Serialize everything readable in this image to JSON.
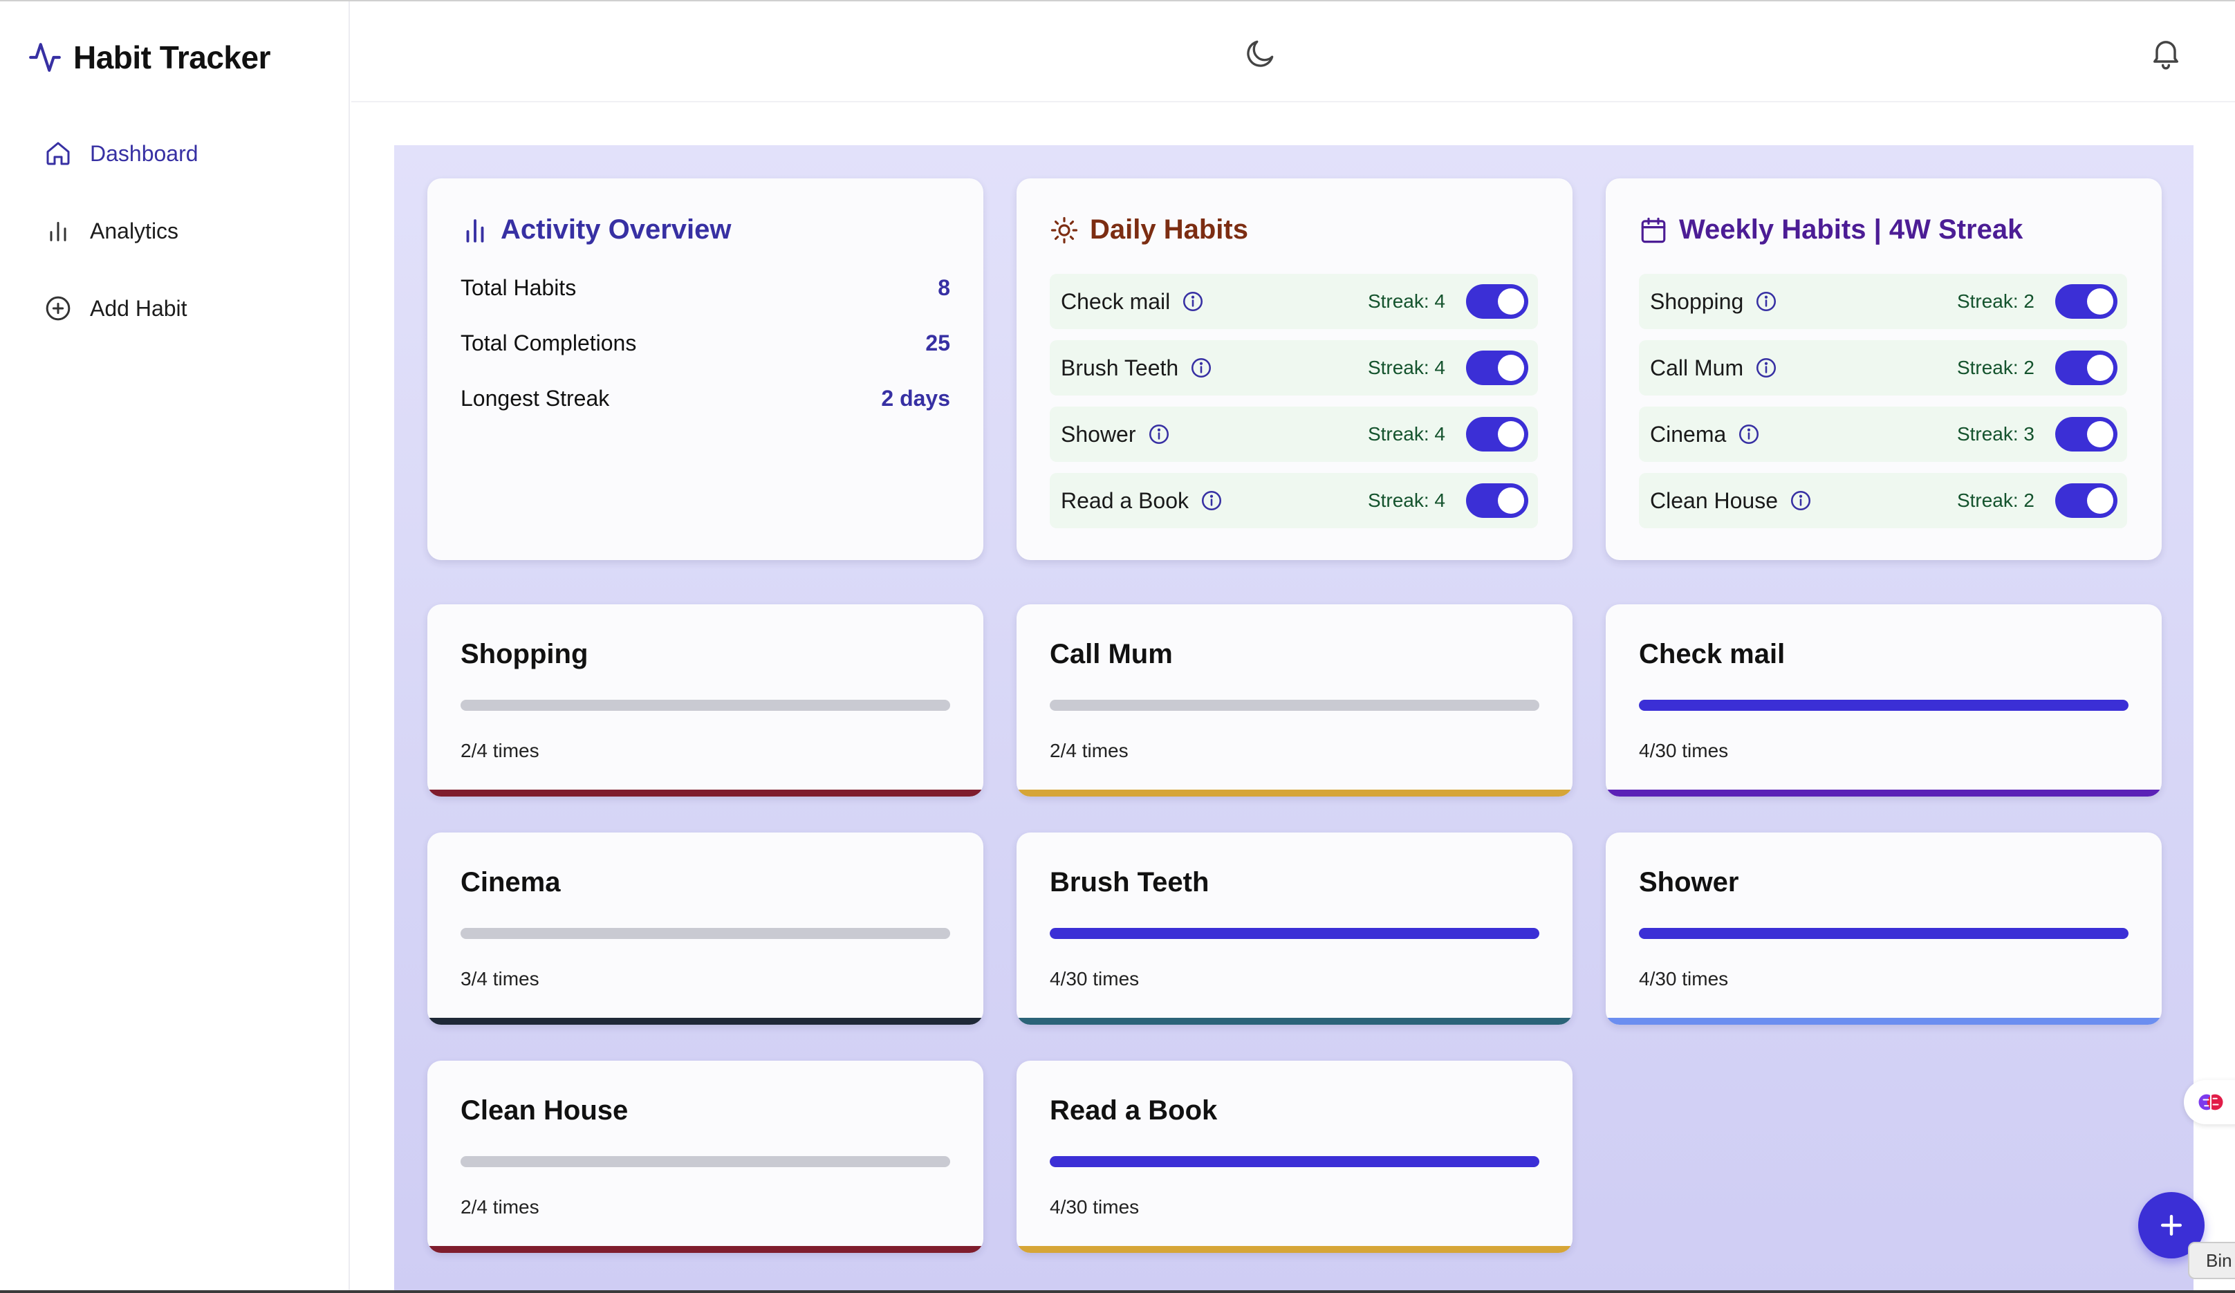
{
  "app": {
    "title": "Habit Tracker"
  },
  "sidebar": {
    "items": [
      {
        "label": "Dashboard",
        "icon": "home-icon",
        "active": true
      },
      {
        "label": "Analytics",
        "icon": "bar-chart-icon",
        "active": false
      },
      {
        "label": "Add Habit",
        "icon": "plus-circle-icon",
        "active": false
      }
    ]
  },
  "header": {
    "theme_icon": "moon-icon",
    "notification_icon": "bell-icon"
  },
  "overview": {
    "title": "Activity Overview",
    "icon": "bar-chart-icon",
    "stats": [
      {
        "label": "Total Habits",
        "value": "8"
      },
      {
        "label": "Total Completions",
        "value": "25"
      },
      {
        "label": "Longest Streak",
        "value": "2 days"
      }
    ]
  },
  "daily": {
    "title": "Daily Habits",
    "icon": "sun-icon",
    "title_color": "#7c2d12",
    "habits": [
      {
        "name": "Check mail",
        "streak": "Streak: 4",
        "on": true
      },
      {
        "name": "Brush Teeth",
        "streak": "Streak: 4",
        "on": true
      },
      {
        "name": "Shower",
        "streak": "Streak: 4",
        "on": true
      },
      {
        "name": "Read a Book",
        "streak": "Streak: 4",
        "on": true
      }
    ]
  },
  "weekly": {
    "title": "Weekly Habits | 4W Streak",
    "icon": "calendar-icon",
    "title_color": "#4c1d95",
    "habits": [
      {
        "name": "Shopping",
        "streak": "Streak: 2",
        "on": true
      },
      {
        "name": "Call Mum",
        "streak": "Streak: 2",
        "on": true
      },
      {
        "name": "Cinema",
        "streak": "Streak: 3",
        "on": true
      },
      {
        "name": "Clean House",
        "streak": "Streak: 2",
        "on": true
      }
    ]
  },
  "progress_cards": [
    {
      "name": "Shopping",
      "count": "2/4 times",
      "progress": 0,
      "accent": "#7f1d2d"
    },
    {
      "name": "Call Mum",
      "count": "2/4 times",
      "progress": 0,
      "accent": "#d6a537"
    },
    {
      "name": "Check mail",
      "count": "4/30 times",
      "progress": 1,
      "accent": "#5b21b6"
    },
    {
      "name": "Cinema",
      "count": "3/4 times",
      "progress": 0,
      "accent": "#1f2937"
    },
    {
      "name": "Brush Teeth",
      "count": "4/30 times",
      "progress": 1,
      "accent": "#2b6378"
    },
    {
      "name": "Shower",
      "count": "4/30 times",
      "progress": 1,
      "accent": "#6b8ef0"
    },
    {
      "name": "Clean House",
      "count": "2/4 times",
      "progress": 0,
      "accent": "#7f1d2d"
    },
    {
      "name": "Read a Book",
      "count": "4/30 times",
      "progress": 1,
      "accent": "#d6a537"
    }
  ],
  "colors": {
    "primary": "#3b2fd6",
    "accent_text": "#3730a3",
    "track": "#c9cad2"
  },
  "fab": {
    "icon": "plus-icon"
  },
  "extension": {
    "icon": "brain-icon",
    "tab_label": "Bin"
  }
}
